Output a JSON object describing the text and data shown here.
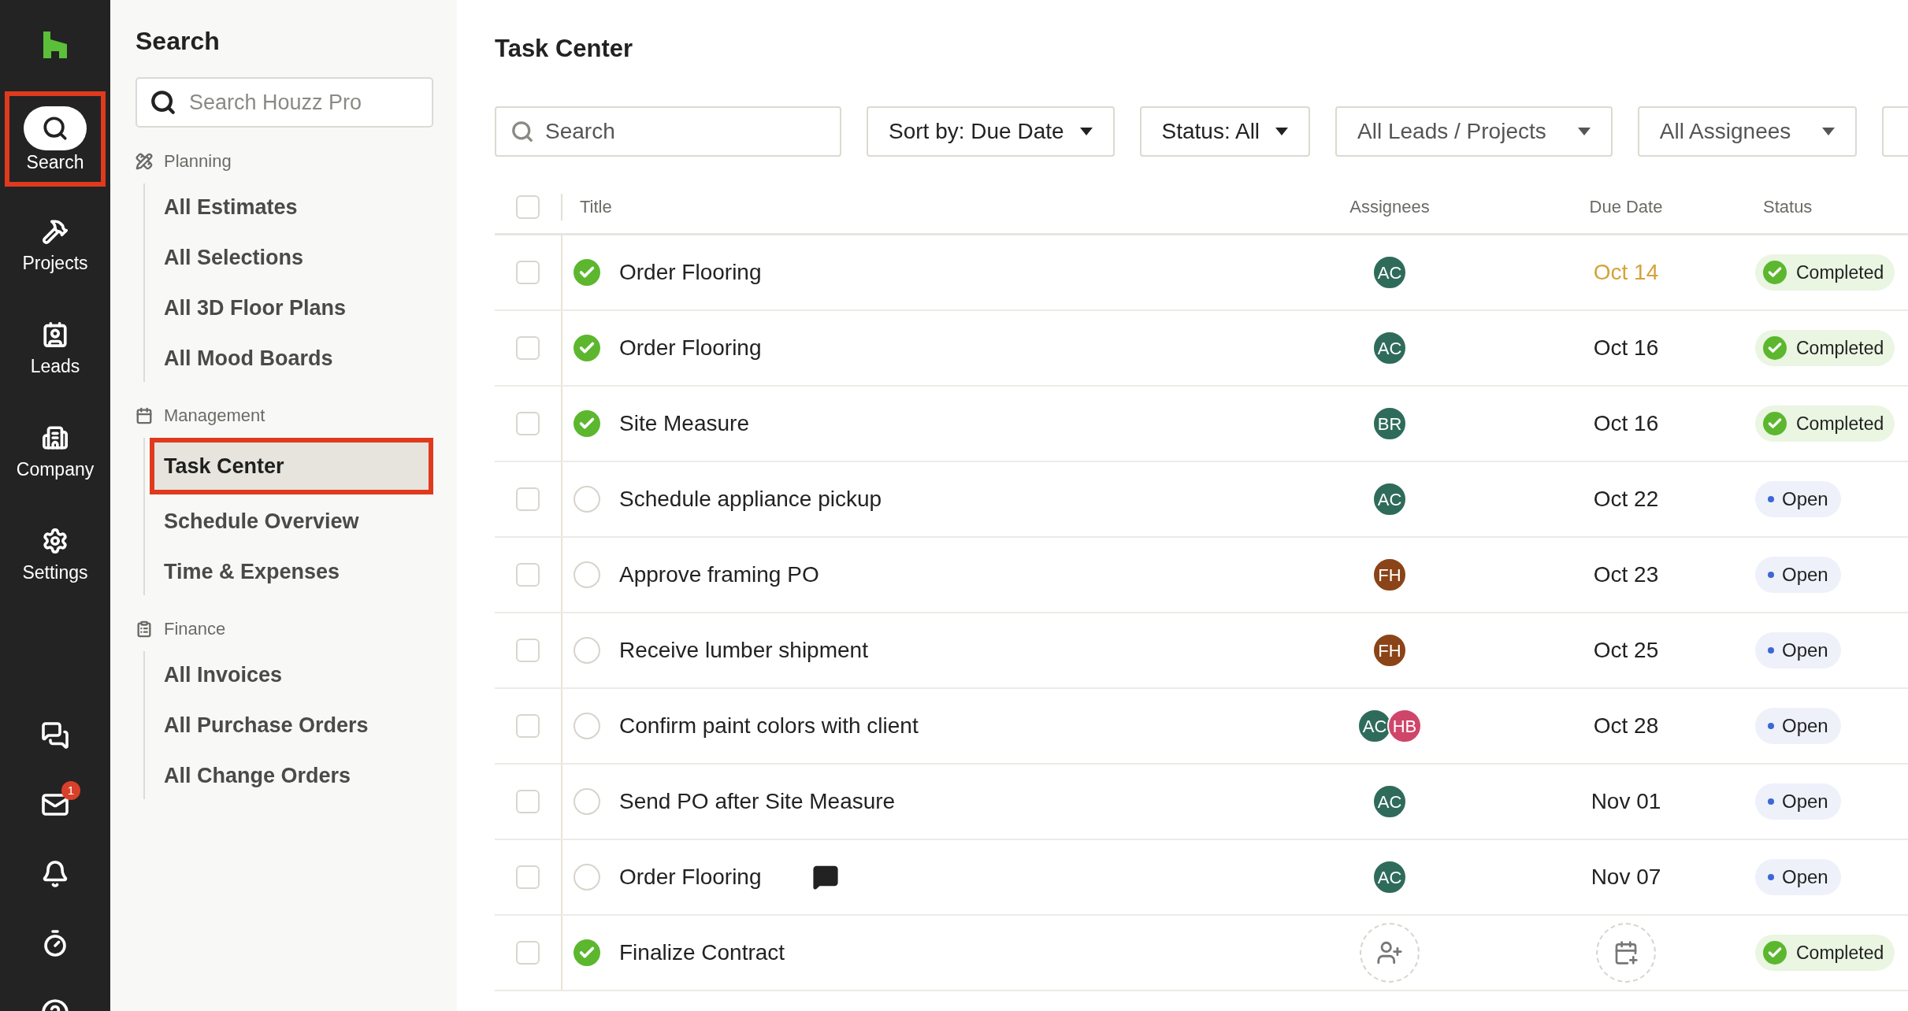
{
  "rail": {
    "items": [
      {
        "kind": "search",
        "label": "Search",
        "selected": true,
        "highlighted": true
      },
      {
        "kind": "projects",
        "label": "Projects",
        "selected": false,
        "highlighted": false
      },
      {
        "kind": "leads",
        "label": "Leads",
        "selected": false,
        "highlighted": false
      },
      {
        "kind": "company",
        "label": "Company",
        "selected": false,
        "highlighted": false
      },
      {
        "kind": "settings",
        "label": "Settings",
        "selected": false,
        "highlighted": false
      }
    ],
    "bottom": [
      {
        "kind": "chat"
      },
      {
        "kind": "inbox",
        "badge": "1"
      },
      {
        "kind": "bell"
      },
      {
        "kind": "timer"
      },
      {
        "kind": "help"
      }
    ]
  },
  "sidebar": {
    "title": "Search",
    "search": {
      "placeholder": "Search Houzz Pro"
    },
    "sections": [
      {
        "kind": "planning",
        "label": "Planning",
        "items": [
          {
            "label": "All Estimates",
            "selected": false,
            "highlighted": false
          },
          {
            "label": "All Selections",
            "selected": false,
            "highlighted": false
          },
          {
            "label": "All 3D Floor Plans",
            "selected": false,
            "highlighted": false
          },
          {
            "label": "All Mood Boards",
            "selected": false,
            "highlighted": false
          }
        ]
      },
      {
        "kind": "management",
        "label": "Management",
        "items": [
          {
            "label": "Task Center",
            "selected": true,
            "highlighted": true
          },
          {
            "label": "Schedule Overview",
            "selected": false,
            "highlighted": false
          },
          {
            "label": "Time & Expenses",
            "selected": false,
            "highlighted": false
          }
        ]
      },
      {
        "kind": "finance",
        "label": "Finance",
        "items": [
          {
            "label": "All Invoices",
            "selected": false,
            "highlighted": false
          },
          {
            "label": "All Purchase Orders",
            "selected": false,
            "highlighted": false
          },
          {
            "label": "All Change Orders",
            "selected": false,
            "highlighted": false
          }
        ]
      }
    ]
  },
  "main": {
    "title": "Task Center",
    "search": {
      "placeholder": "Search"
    },
    "filters": [
      {
        "label": "Sort by: Due Date",
        "kind": "dark"
      },
      {
        "label": "Status: All",
        "kind": "dark"
      },
      {
        "label": "All Leads / Projects",
        "kind": "light"
      },
      {
        "label": "All Assignees",
        "kind": "light"
      }
    ],
    "table": {
      "columns": [
        "Title",
        "Assignees",
        "Due Date",
        "Status"
      ],
      "all_checked": false,
      "rows": [
        {
          "checked": false,
          "done": true,
          "title": "Order Flooring",
          "comment": false,
          "assignees": [
            {
              "initials": "AC",
              "color": "#2f6b5b"
            }
          ],
          "due": "Oct 14",
          "overdue": true,
          "status": {
            "kind": "completed",
            "label": "Completed"
          }
        },
        {
          "checked": false,
          "done": true,
          "title": "Order Flooring",
          "comment": false,
          "assignees": [
            {
              "initials": "AC",
              "color": "#2f6b5b"
            }
          ],
          "due": "Oct 16",
          "overdue": false,
          "status": {
            "kind": "completed",
            "label": "Completed"
          }
        },
        {
          "checked": false,
          "done": true,
          "title": "Site Measure",
          "comment": false,
          "assignees": [
            {
              "initials": "BR",
              "color": "#2f6b5b"
            }
          ],
          "due": "Oct 16",
          "overdue": false,
          "status": {
            "kind": "completed",
            "label": "Completed"
          }
        },
        {
          "checked": false,
          "done": false,
          "title": "Schedule appliance pickup",
          "comment": false,
          "assignees": [
            {
              "initials": "AC",
              "color": "#2f6b5b"
            }
          ],
          "due": "Oct 22",
          "overdue": false,
          "status": {
            "kind": "open",
            "label": "Open"
          }
        },
        {
          "checked": false,
          "done": false,
          "title": "Approve framing PO",
          "comment": false,
          "assignees": [
            {
              "initials": "FH",
              "color": "#8a4417"
            }
          ],
          "due": "Oct 23",
          "overdue": false,
          "status": {
            "kind": "open",
            "label": "Open"
          }
        },
        {
          "checked": false,
          "done": false,
          "title": "Receive lumber shipment",
          "comment": false,
          "assignees": [
            {
              "initials": "FH",
              "color": "#8a4417"
            }
          ],
          "due": "Oct 25",
          "overdue": false,
          "status": {
            "kind": "open",
            "label": "Open"
          }
        },
        {
          "checked": false,
          "done": false,
          "title": "Confirm paint colors with client",
          "comment": false,
          "assignees": [
            {
              "initials": "AC",
              "color": "#2f6b5b"
            },
            {
              "initials": "HB",
              "color": "#d0456a"
            }
          ],
          "due": "Oct 28",
          "overdue": false,
          "status": {
            "kind": "open",
            "label": "Open"
          }
        },
        {
          "checked": false,
          "done": false,
          "title": "Send PO after Site Measure",
          "comment": false,
          "assignees": [
            {
              "initials": "AC",
              "color": "#2f6b5b"
            }
          ],
          "due": "Nov 01",
          "overdue": false,
          "status": {
            "kind": "open",
            "label": "Open"
          }
        },
        {
          "checked": false,
          "done": false,
          "title": "Order Flooring",
          "comment": true,
          "assignees": [
            {
              "initials": "AC",
              "color": "#2f6b5b"
            }
          ],
          "due": "Nov 07",
          "overdue": false,
          "status": {
            "kind": "open",
            "label": "Open"
          }
        },
        {
          "checked": false,
          "done": true,
          "title": "Finalize Contract",
          "comment": false,
          "status": {
            "kind": "completed",
            "label": "Completed"
          }
        }
      ]
    }
  }
}
